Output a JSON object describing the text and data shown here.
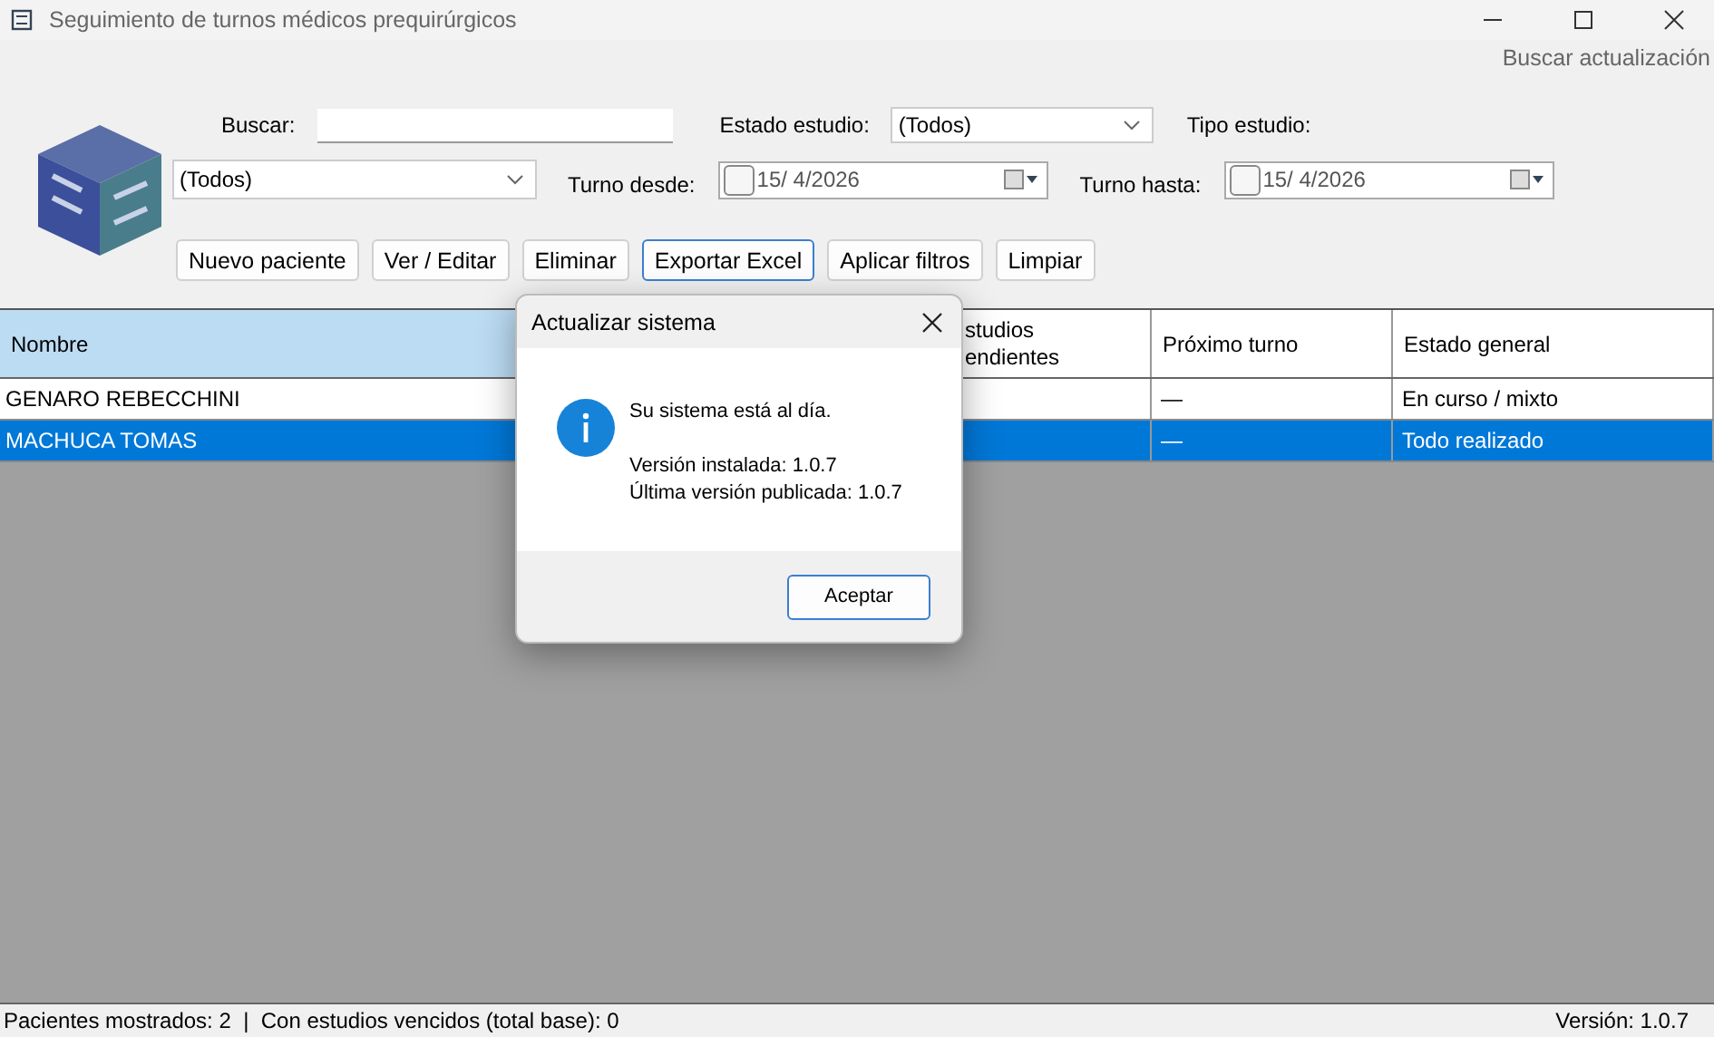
{
  "window": {
    "title": "Seguimiento de turnos médicos prequirúrgicos"
  },
  "menu": [
    {
      "label": "Buscar actualización"
    }
  ],
  "filters": {
    "search_label": "Buscar:",
    "estado_label": "Estado estudio:",
    "estado_value": "(Todos)",
    "tipo_label": "Tipo estudio:",
    "tipo_value": "(Todos)",
    "desde_label": "Turno desde:",
    "desde_value": "15/  4/2026",
    "desde_checked": false,
    "hasta_label": "Turno hasta:",
    "hasta_value": "15/  4/2026",
    "hasta_checked": false
  },
  "buttons": [
    {
      "label": "Nuevo paciente",
      "focused": false
    },
    {
      "label": "Ver / Editar",
      "focused": false
    },
    {
      "label": "Eliminar",
      "focused": false
    },
    {
      "label": "Exportar Excel",
      "focused": true
    },
    {
      "label": "Aplicar filtros",
      "focused": false
    },
    {
      "label": "Limpiar",
      "focused": false
    }
  ],
  "table": {
    "columns": [
      {
        "label": "Nombre",
        "selected": true
      },
      {
        "label": "studios endientes",
        "selected": false
      },
      {
        "label": "Próximo turno",
        "selected": false
      },
      {
        "label": "Estado general",
        "selected": false
      }
    ],
    "rows": [
      {
        "name": "GENARO REBECCHINI",
        "next_turn": "—",
        "status": "En curso / mixto",
        "selected": false
      },
      {
        "name": "MACHUCA TOMAS",
        "next_turn": "—",
        "status": "Todo realizado",
        "selected": true
      }
    ]
  },
  "dialog": {
    "title": "Actualizar sistema",
    "message": "Su sistema está al día.",
    "lines": [
      "Versión instalada: 1.0.7",
      "Última versión publicada: 1.0.7"
    ],
    "button": "Aceptar"
  },
  "status_bar": {
    "left": "Pacientes mostrados: 2  |  Con estudios vencidos (total base): 0",
    "right": "Versión: 1.0.7"
  }
}
